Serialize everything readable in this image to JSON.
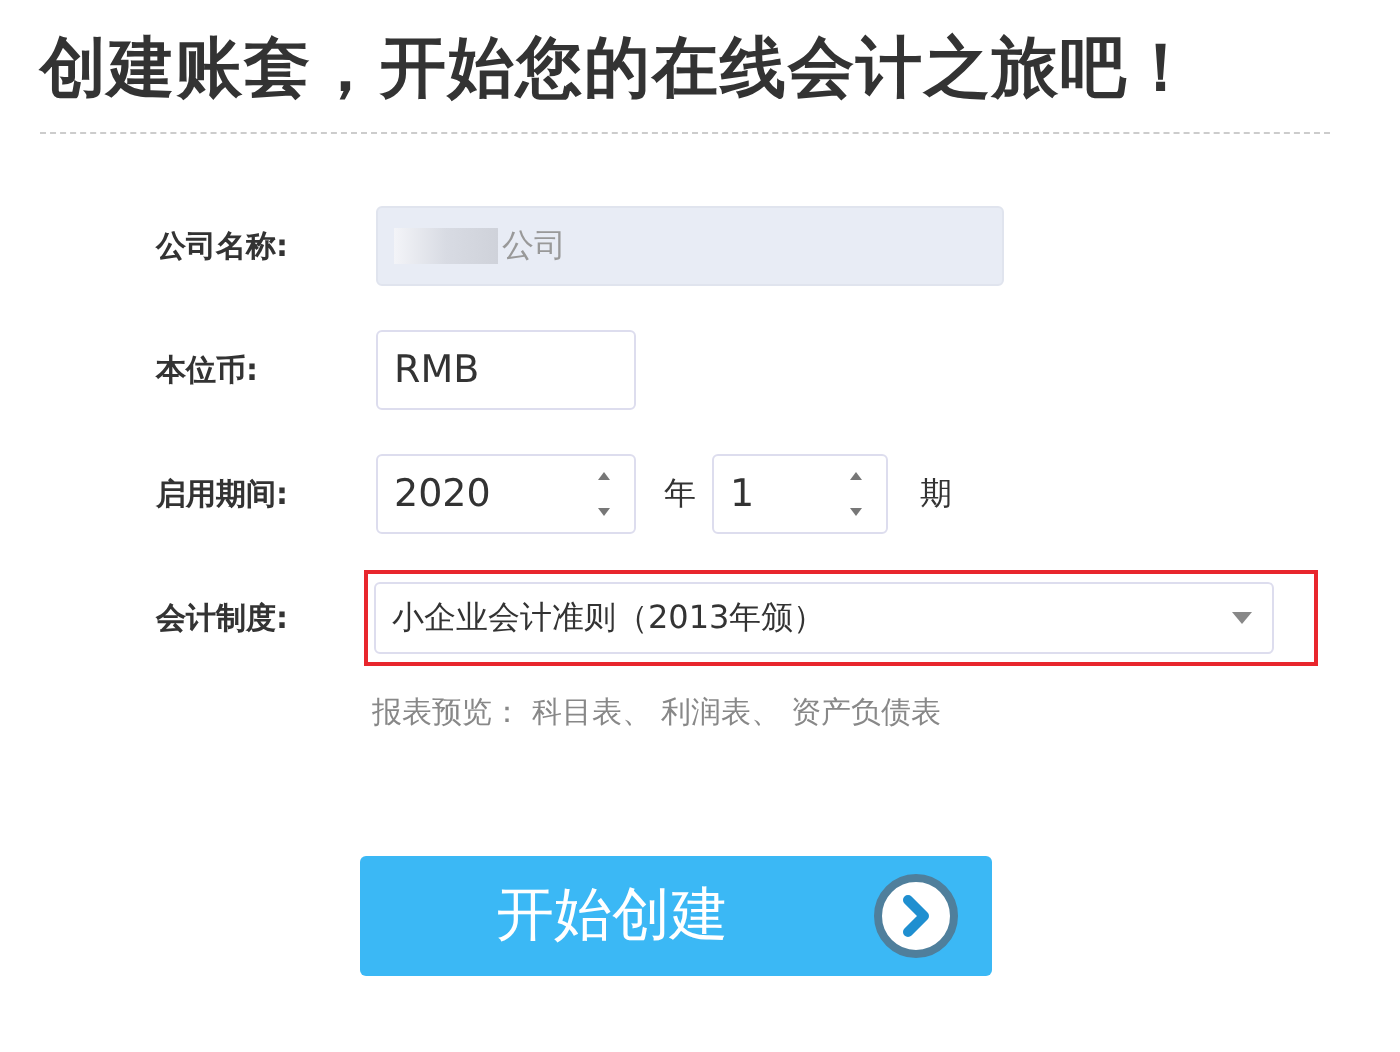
{
  "title": "创建账套，开始您的在线会计之旅吧！",
  "fields": [
    {
      "kind": "text",
      "label": "公司名称:",
      "value": "公司",
      "disabled": true,
      "redacted": true
    },
    {
      "kind": "text",
      "label": "本位币:",
      "value": "RMB",
      "disabled": false
    },
    {
      "kind": "period",
      "label": "启用期间:",
      "year": "2020",
      "year_unit": "年",
      "period": "1",
      "period_unit": "期"
    },
    {
      "kind": "select",
      "label": "会计制度:",
      "value": "小企业会计准则（2013年颁）",
      "highlighted": true
    }
  ],
  "preview": "报表预览： 科目表、 利润表、 资产负债表",
  "submit": "开始创建"
}
